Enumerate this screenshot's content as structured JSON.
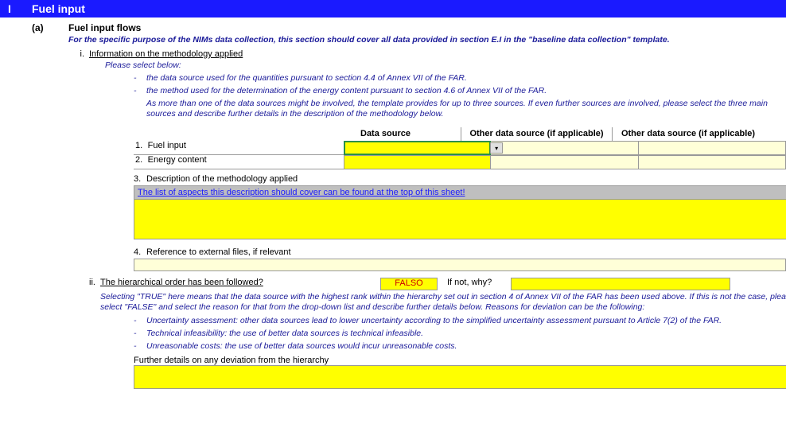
{
  "section": {
    "code": "I",
    "title": "Fuel input"
  },
  "sub": {
    "letter": "(a)",
    "title": "Fuel input flows",
    "note": "For the specific purpose of the NIMs data collection, this section should cover all data provided in section E.I in the \"baseline data collection\" template."
  },
  "i": {
    "num": "i.",
    "title": "Information on the methodology applied",
    "please": "Please select below:",
    "d1": "the data source used for the quantities pursuant to section 4.4 of Annex VII of the FAR.",
    "d2": "the method used for the determination of the energy content pursuant to section 4.6 of Annex VII of the FAR.",
    "d3": "As more than one of the data sources might be involved, the template provides for up to three sources. If even further sources are involved, please select the three main sources and describe further details in the description of the methodology below."
  },
  "headers": {
    "c1": "Data source",
    "c2": "Other data source (if applicable)",
    "c3": "Other data source (if applicable)"
  },
  "rows": {
    "r1num": "1.",
    "r1": "Fuel input",
    "r2num": "2.",
    "r2": "Energy content",
    "r3num": "3.",
    "r3": "Description of the methodology applied",
    "r3link": "The list of aspects this description should cover can be found at the top of this sheet!",
    "r4num": "4.",
    "r4": "Reference to external files, if relevant"
  },
  "ii": {
    "num": "ii.",
    "q": "The hierarchical order has been followed?",
    "val": "FALSO",
    "why": "If not, why?",
    "note": "Selecting \"TRUE\" here means that the data source with the highest rank within the hierarchy set out in section 4 of Annex VII of the FAR has been used above. If this is not the case, please select \"FALSE\" and select the reason for that from the drop-down list and describe further details below. Reasons for deviation can be the following:",
    "b1": "Uncertainty assessment: other data sources lead to lower uncertainty according to the simplified uncertainty assessment pursuant to Article 7(2) of the FAR.",
    "b2": "Technical infeasibility: the use of better data sources is technical infeasible.",
    "b3": "Unreasonable costs: the use of better data sources would incur unreasonable costs.",
    "further": "Further details on any deviation from the hierarchy"
  }
}
